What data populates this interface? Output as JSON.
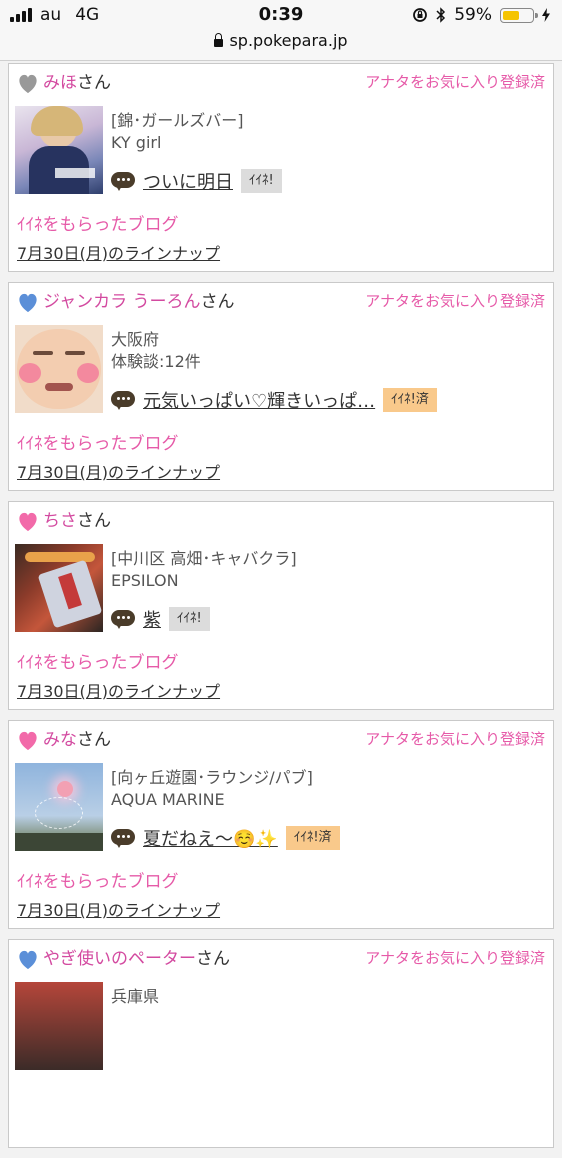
{
  "status_bar": {
    "carrier": "au",
    "network": "4G",
    "time": "0:39",
    "battery_percent": "59%",
    "battery_level": 0.59
  },
  "url_bar": {
    "url": "sp.pokepara.jp"
  },
  "cards": [
    {
      "heart_color": "#999999",
      "name": "みほ",
      "honorific": "さん",
      "favorite_label": "アナタをお気に入り登録済",
      "info_line1": "[錦･ガールズバー]",
      "info_line2": "KY girl",
      "blog_title": "ついに明日",
      "iine_label": "ｲｲﾈ!",
      "iine_done": false,
      "got_blog_label": "ｲｲﾈをもらったブログ",
      "lineup_label": "7月30日(月)のラインナップ"
    },
    {
      "heart_color": "#5b8fd8",
      "name": "ジャンカラ うーろん",
      "honorific": "さん",
      "favorite_label": "アナタをお気に入り登録済",
      "info_line1": "大阪府",
      "info_line2": "体験談:12件",
      "blog_title": "元気いっぱい♡輝きいっぱ…",
      "iine_label": "ｲｲﾈ!済",
      "iine_done": true,
      "got_blog_label": "ｲｲﾈをもらったブログ",
      "lineup_label": "7月30日(月)のラインナップ"
    },
    {
      "heart_color": "#f26aa9",
      "name": "ちさ",
      "honorific": "さん",
      "favorite_label": "",
      "info_line1": "[中川区 高畑･キャバクラ]",
      "info_line2": "EPSILON",
      "blog_title": "紫",
      "iine_label": "ｲｲﾈ!",
      "iine_done": false,
      "got_blog_label": "ｲｲﾈをもらったブログ",
      "lineup_label": "7月30日(月)のラインナップ"
    },
    {
      "heart_color": "#f26aa9",
      "name": "みな",
      "honorific": "さん",
      "favorite_label": "アナタをお気に入り登録済",
      "info_line1": "[向ヶ丘遊園･ラウンジ/パブ]",
      "info_line2": "AQUA MARINE",
      "blog_title": "夏だねえ〜☺️✨",
      "iine_label": "ｲｲﾈ!済",
      "iine_done": true,
      "got_blog_label": "ｲｲﾈをもらったブログ",
      "lineup_label": "7月30日(月)のラインナップ"
    },
    {
      "heart_color": "#5b8fd8",
      "name": "やぎ使いのペーター",
      "honorific": "さん",
      "favorite_label": "アナタをお気に入り登録済",
      "info_line1": "兵庫県"
    }
  ],
  "icons": {
    "heart": "heart-icon",
    "comment": "speech-bubble-icon",
    "lock": "lock-icon",
    "bluetooth": "bluetooth-icon",
    "rotation_lock": "rotation-lock-icon",
    "charging": "charging-bolt-icon"
  }
}
